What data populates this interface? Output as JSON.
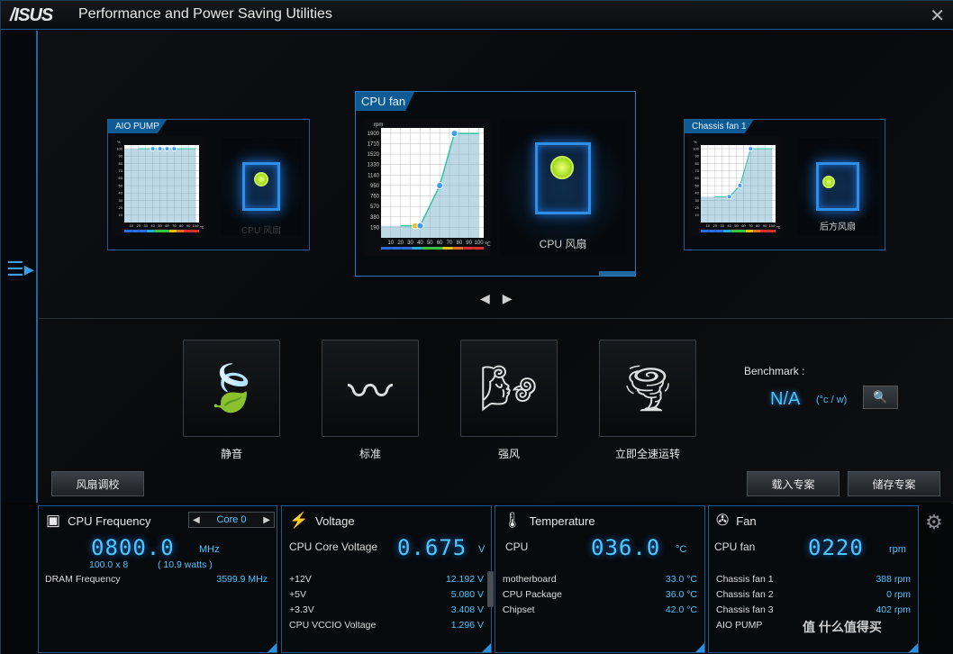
{
  "app": {
    "logo": "/ISUS",
    "title": "Performance and Power Saving Utilities",
    "close": "✕"
  },
  "sidebar": {
    "menu_icon": "menu-icon"
  },
  "fans": {
    "aio": {
      "tab": "AIO PUMP",
      "case_label": "CPU 风扇",
      "y_ticks": [
        "100",
        "90",
        "80",
        "70",
        "60",
        "50",
        "40",
        "30",
        "20",
        "10"
      ],
      "x_ticks": [
        "10",
        "20",
        "30",
        "40",
        "50",
        "60",
        "70",
        "80",
        "90",
        "100"
      ],
      "y_unit": "%",
      "x_unit": "℃",
      "curve": [
        [
          20,
          100
        ],
        [
          40,
          100
        ],
        [
          50,
          100
        ],
        [
          60,
          100
        ],
        [
          70,
          100
        ],
        [
          100,
          100
        ]
      ],
      "points": [
        [
          40,
          100
        ],
        [
          50,
          100
        ],
        [
          60,
          100
        ],
        [
          70,
          100
        ]
      ]
    },
    "cpu": {
      "tab": "CPU fan",
      "case_label": "CPU 风扇",
      "y_ticks": [
        "1900",
        "1710",
        "1520",
        "1330",
        "1140",
        "950",
        "760",
        "570",
        "380",
        "190"
      ],
      "x_ticks": [
        "10",
        "20",
        "30",
        "40",
        "50",
        "60",
        "70",
        "80",
        "90",
        "100"
      ],
      "y_unit": "rpm",
      "x_unit": "℃",
      "curve": [
        [
          20,
          220
        ],
        [
          35,
          220
        ],
        [
          40,
          220
        ],
        [
          60,
          950
        ],
        [
          75,
          1900
        ],
        [
          100,
          1900
        ]
      ],
      "points": [
        [
          35,
          220
        ],
        [
          40,
          220
        ],
        [
          60,
          950
        ],
        [
          75,
          1900
        ]
      ]
    },
    "chassis": {
      "tab": "Chassis fan 1",
      "case_label": "后方风扇",
      "y_ticks": [
        "100",
        "90",
        "80",
        "70",
        "60",
        "50",
        "40",
        "30",
        "20",
        "10"
      ],
      "x_ticks": [
        "10",
        "20",
        "30",
        "40",
        "50",
        "60",
        "70",
        "80",
        "90",
        "100"
      ],
      "y_unit": "%",
      "x_unit": "℃",
      "curve": [
        [
          20,
          35
        ],
        [
          40,
          35
        ],
        [
          55,
          50
        ],
        [
          70,
          100
        ],
        [
          100,
          100
        ]
      ],
      "points": [
        [
          40,
          35
        ],
        [
          55,
          50
        ],
        [
          70,
          100
        ]
      ]
    }
  },
  "nav": {
    "prev": "◀",
    "next": "▶"
  },
  "modes": [
    {
      "label": "静音",
      "icon": "leaf-wind-icon"
    },
    {
      "label": "标准",
      "icon": "grass-wind-icon"
    },
    {
      "label": "强风",
      "icon": "strong-wind-icon"
    },
    {
      "label": "立即全速运转",
      "icon": "tornado-icon"
    }
  ],
  "benchmark": {
    "label": "Benchmark :",
    "value": "N/A",
    "unit": "(°c / w)"
  },
  "buttons": {
    "tune": "风扇调校",
    "load": "载入专案",
    "save": "储存专案"
  },
  "cpu_freq": {
    "title": "CPU Frequency",
    "core": "Core 0",
    "value": "0800.0",
    "unit": "MHz",
    "multiplier": "100.0   x  8",
    "watts": "( 10.9   watts )",
    "dram_label": "DRAM Frequency",
    "dram_value": "3599.9  MHz"
  },
  "voltage": {
    "title": "Voltage",
    "main_label": "CPU Core Voltage",
    "main_value": "0.675",
    "main_unit": "V",
    "rows": [
      {
        "label": "+12V",
        "value": "12.192  V"
      },
      {
        "label": "+5V",
        "value": "5.080  V"
      },
      {
        "label": "+3.3V",
        "value": "3.408  V"
      },
      {
        "label": "CPU VCCIO Voltage",
        "value": "1.296  V"
      }
    ]
  },
  "temperature": {
    "title": "Temperature",
    "main_label": "CPU",
    "main_value": "036.0",
    "main_unit": "°C",
    "rows": [
      {
        "label": "motherboard",
        "value": "33.0 °C"
      },
      {
        "label": "CPU Package",
        "value": "36.0 °C"
      },
      {
        "label": "Chipset",
        "value": "42.0 °C"
      }
    ]
  },
  "fan_panel": {
    "title": "Fan",
    "main_label": "CPU fan",
    "main_value": "0220",
    "main_unit": "rpm",
    "rows": [
      {
        "label": "Chassis fan 1",
        "value": "388  rpm"
      },
      {
        "label": "Chassis fan 2",
        "value": "0  rpm"
      },
      {
        "label": "Chassis fan 3",
        "value": "402  rpm"
      },
      {
        "label": "AIO PUMP",
        "value": ""
      }
    ]
  },
  "watermark": "值 什么值得买",
  "colors": {
    "accent": "#1e6aa0",
    "value": "#4ac8ff",
    "curve": "#2ec4a0",
    "point": "#3a9eff"
  }
}
